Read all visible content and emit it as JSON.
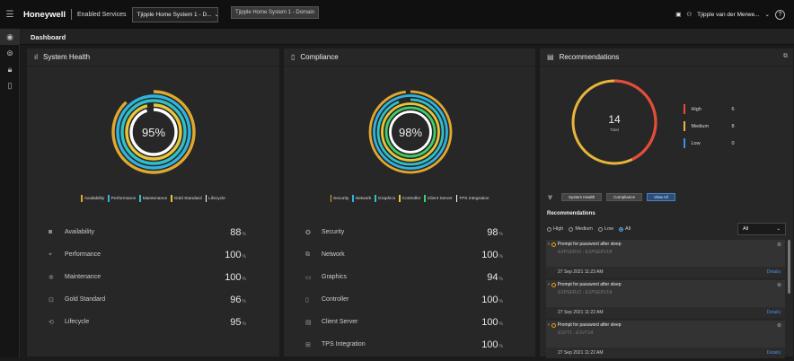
{
  "topbar": {
    "brand": "Honeywell",
    "services": "Enabled Services",
    "system_select": "Tjipple Home System 1 - D...",
    "tooltip": "Tjipple Home System 1 - Domain",
    "user": "Tjipple van der Merwe..."
  },
  "dashboard": {
    "title": "Dashboard"
  },
  "system_health": {
    "title": "System Health",
    "gauge_value": "95%",
    "legend": [
      {
        "label": "Availability",
        "color": "#e0a82e"
      },
      {
        "label": "Performance",
        "color": "#2fb3e0"
      },
      {
        "label": "Maintenance",
        "color": "#30c0c8"
      },
      {
        "label": "Gold Standard",
        "color": "#e8c53a"
      },
      {
        "label": "Lifecycle",
        "color": "#ffffff"
      }
    ],
    "metrics": [
      {
        "icon": "availability-icon",
        "glyph": "◙",
        "label": "Availability",
        "value": "88",
        "unit": "%"
      },
      {
        "icon": "performance-icon",
        "glyph": "⌖",
        "label": "Performance",
        "value": "100",
        "unit": "%"
      },
      {
        "icon": "maintenance-icon",
        "glyph": "✲",
        "label": "Maintenance",
        "value": "100",
        "unit": "%"
      },
      {
        "icon": "gold-standard-icon",
        "glyph": "⊡",
        "label": "Gold Standard",
        "value": "96",
        "unit": "%"
      },
      {
        "icon": "lifecycle-icon",
        "glyph": "⟲",
        "label": "Lifecycle",
        "value": "95",
        "unit": "%"
      }
    ]
  },
  "compliance": {
    "title": "Compliance",
    "gauge_value": "98%",
    "legend": [
      {
        "label": "Security",
        "color": "#e0a82e"
      },
      {
        "label": "Network",
        "color": "#2fb3e0"
      },
      {
        "label": "Graphics",
        "color": "#30c0c8"
      },
      {
        "label": "Controller",
        "color": "#e8c53a"
      },
      {
        "label": "Client Server",
        "color": "#3ecf6a"
      },
      {
        "label": "TPS Integration",
        "color": "#ffffff"
      }
    ],
    "metrics": [
      {
        "icon": "security-icon",
        "glyph": "✪",
        "label": "Security",
        "value": "98",
        "unit": "%"
      },
      {
        "icon": "network-icon",
        "glyph": "⧉",
        "label": "Network",
        "value": "100",
        "unit": "%"
      },
      {
        "icon": "graphics-icon",
        "glyph": "▭",
        "label": "Graphics",
        "value": "94",
        "unit": "%"
      },
      {
        "icon": "controller-icon",
        "glyph": "▯",
        "label": "Controller",
        "value": "100",
        "unit": "%"
      },
      {
        "icon": "client-server-icon",
        "glyph": "▤",
        "label": "Client Server",
        "value": "100",
        "unit": "%"
      },
      {
        "icon": "tps-integration-icon",
        "glyph": "⊞",
        "label": "TPS Integration",
        "value": "100",
        "unit": "%"
      }
    ]
  },
  "recommendations": {
    "title": "Recommendations",
    "total": "14",
    "total_label": "Total",
    "priorities": [
      {
        "label": "High",
        "count": "6",
        "color": "#e84a3a"
      },
      {
        "label": "Medium",
        "count": "8",
        "color": "#e8b53a"
      },
      {
        "label": "Low",
        "count": "0",
        "color": "#3a8fe0"
      }
    ],
    "filters": [
      "System Health",
      "Compliance",
      "View All"
    ],
    "list_title": "Recommendations",
    "radios": [
      "High",
      "Medium",
      "Low",
      "All"
    ],
    "select_value": "All",
    "items": [
      {
        "title": "Prompt for password after sleep",
        "sub": "EXPSERV1 - EXPSERV1B",
        "date": "27 Sep 2021 11:23 AM",
        "details": "Details"
      },
      {
        "title": "Prompt for password after sleep",
        "sub": "EXPSERV1 - EXPSERV1A",
        "date": "27 Sep 2021 11:22 AM",
        "details": "Details"
      },
      {
        "title": "Prompt for password after sleep",
        "sub": "ESVT1 - ESVT1A",
        "date": "27 Sep 2021 11:22 AM",
        "details": "Details"
      }
    ]
  }
}
